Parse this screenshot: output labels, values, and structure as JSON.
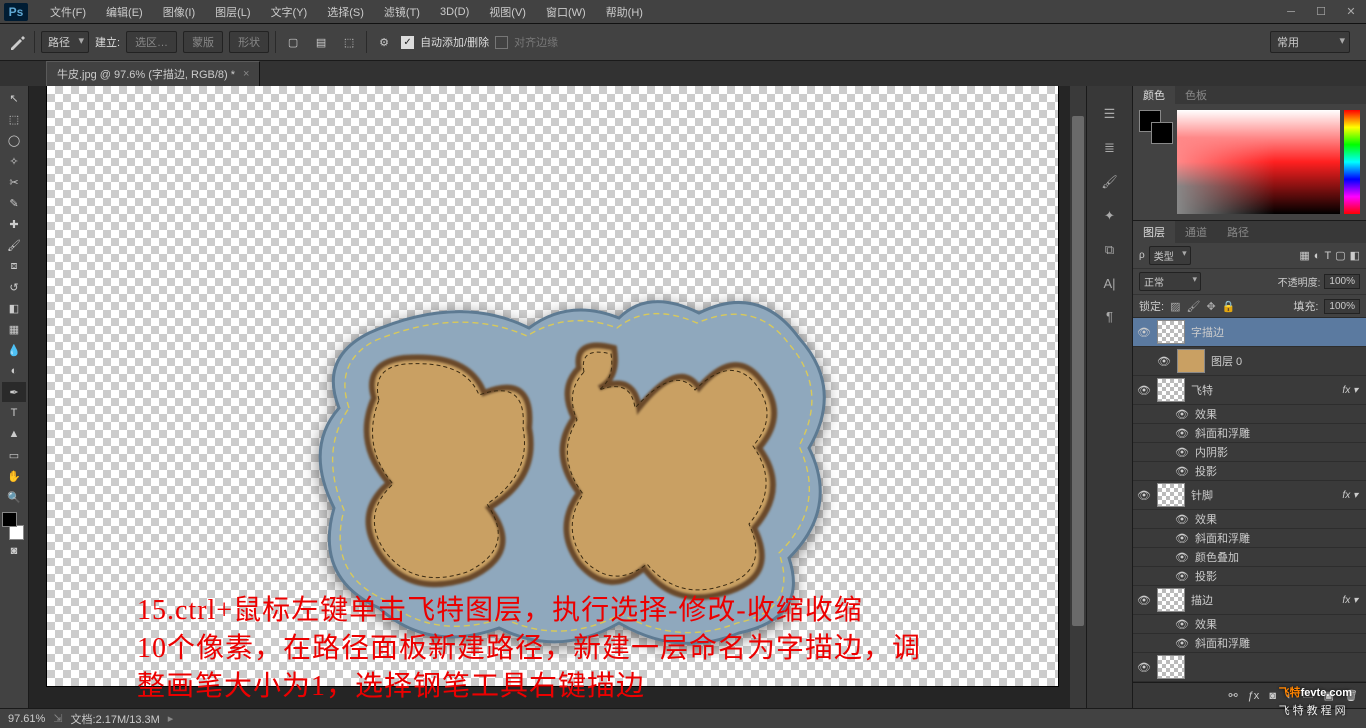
{
  "menu": {
    "items": [
      "文件(F)",
      "编辑(E)",
      "图像(I)",
      "图层(L)",
      "文字(Y)",
      "选择(S)",
      "滤镜(T)",
      "3D(D)",
      "视图(V)",
      "窗口(W)",
      "帮助(H)"
    ]
  },
  "options": {
    "path_mode": "路径",
    "make_label": "建立:",
    "btn_selection": "选区…",
    "btn_mask": "蒙版",
    "btn_shape": "形状",
    "auto_add_label": "自动添加/删除",
    "align_label": "对齐边缘",
    "workspace": "常用"
  },
  "doc": {
    "tab_title": "牛皮.jpg @ 97.6% (字描边, RGB/8) *"
  },
  "canvas": {
    "annotation_line1": "15.ctrl+鼠标左键单击飞特图层，执行选择-修改-收缩收缩",
    "annotation_line2": "10个像素，在路径面板新建路径，新建一层命名为字描边，调",
    "annotation_line3": "整画笔大小为1，选择钢笔工具右键描边"
  },
  "status": {
    "zoom": "97.61%",
    "doc_info": "文档:2.17M/13.3M"
  },
  "panels": {
    "color_tabs": [
      "颜色",
      "色板"
    ],
    "layers_tabs": [
      "图层",
      "通道",
      "路径"
    ],
    "kind_label": "类型",
    "blend_mode": "正常",
    "opacity_label": "不透明度:",
    "opacity_value": "100%",
    "lock_label": "锁定:",
    "fill_label": "填充:",
    "fill_value": "100%",
    "layers": [
      {
        "name": "字描边",
        "thumb": "checker",
        "selected": true
      },
      {
        "name": "图层 0",
        "thumb": "tan",
        "indent": true
      },
      {
        "name": "飞特",
        "thumb": "checker",
        "fx": true,
        "effects": [
          "效果",
          "斜面和浮雕",
          "内阴影",
          "投影"
        ]
      },
      {
        "name": "针脚",
        "thumb": "checker",
        "fx": true,
        "effects": [
          "效果",
          "斜面和浮雕",
          "颜色叠加",
          "投影"
        ]
      },
      {
        "name": "描边",
        "thumb": "checker",
        "fx": true,
        "effects": [
          "效果",
          "斜面和浮雕"
        ]
      },
      {
        "name": "",
        "thumb": "checker"
      }
    ]
  },
  "watermark": {
    "brand": "飞特",
    "domain": "fevte.com",
    "sub": "飞特教程网"
  }
}
